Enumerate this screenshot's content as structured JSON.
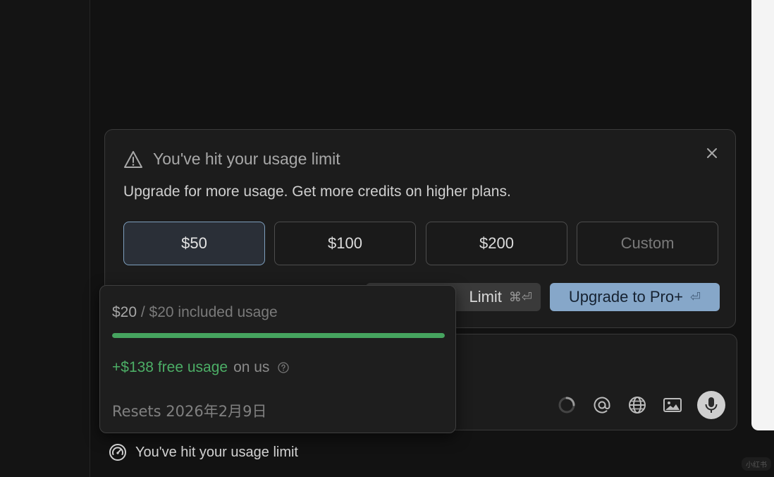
{
  "limit_card": {
    "title": "You've hit your usage limit",
    "subtitle": "Upgrade for more usage. Get more credits on higher plans.",
    "amounts": [
      "$50",
      "$100",
      "$200",
      "Custom"
    ],
    "selected_amount": "$50",
    "limit_button": {
      "label": "Limit",
      "shortcut": "⌘⏎"
    },
    "upgrade_button": {
      "label": "Upgrade to Pro+",
      "shortcut": "⏎"
    }
  },
  "usage_popover": {
    "used": "$20",
    "included": " / $20 included usage",
    "progress_fraction": 1.0,
    "free_amount": "+$138 free usage",
    "free_suffix": "on us",
    "resets": "Resets 2026年2月9日"
  },
  "status_bar": {
    "text": "You've hit your usage limit"
  },
  "watermark": "小红书",
  "colors": {
    "accent": "#86a7c9",
    "progress": "#46a45f",
    "free_text": "#4cae66"
  },
  "icons": [
    "warning-icon",
    "close-icon",
    "help-icon",
    "spinner-icon",
    "at-icon",
    "globe-icon",
    "image-icon",
    "mic-icon",
    "gauge-icon"
  ]
}
